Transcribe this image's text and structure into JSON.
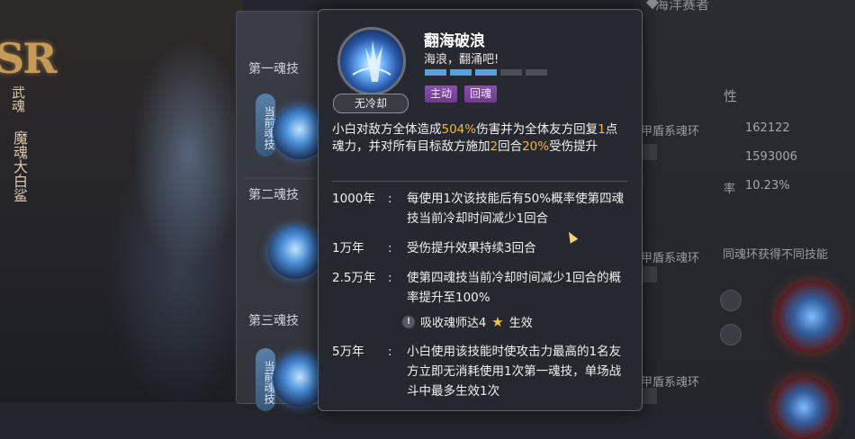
{
  "background": {
    "rank_badge": "SR",
    "hero_vertical_1": "武魂",
    "hero_vertical_2": "魔魂大白鲨",
    "skill_slots": [
      {
        "title": "第一魂技",
        "pre_tag": "当前魂技"
      },
      {
        "title": "第二魂技"
      },
      {
        "title": "第三魂技",
        "pre_tag": "当前魂技"
      }
    ],
    "right_panel": {
      "header": "海洋赛者",
      "partial_attr": "性",
      "rows": [
        {
          "label": "甲盾系魂环",
          "value": "162122"
        },
        {
          "label": "",
          "value": "1593006"
        },
        {
          "label": "率",
          "value": "10.23%"
        }
      ],
      "row2_label": "甲盾系魂环",
      "row3_label": "甲盾系魂环",
      "notice": "同魂环获得不同技能"
    }
  },
  "tooltip": {
    "skill_name": "翻海破浪",
    "quote": "海浪，翻涌吧!",
    "cooldown_badge": "无冷却",
    "level_pips": {
      "filled": 3,
      "total": 5
    },
    "tags": [
      "主动",
      "回魂"
    ],
    "description": {
      "p1": "小白对敌方全体造成",
      "hl1": "504%",
      "p2": "伤害并为全体友方回复",
      "hl2": "1",
      "p3": "点魂力，并对所有目标敌方施加",
      "hl3": "2",
      "p4": "回合",
      "hl4": "20%",
      "p5": "受伤提升"
    },
    "levels": [
      {
        "key": "1000年",
        "colon": ":",
        "text": "每使用1次该技能后有50%概率使第四魂技当前冷却时间减少1回合"
      },
      {
        "key": "1万年",
        "colon": ":",
        "text": "受伤提升效果持续3回合"
      },
      {
        "key": "2.5万年",
        "colon": ":",
        "text": "使第四魂技当前冷却时间减少1回合的概率提升至100%"
      },
      {
        "key": "5万年",
        "colon": ":",
        "text": "小白使用该技能时使攻击力最高的1名友方立即无消耗使用1次第一魂技，单场战斗中最多生效1次"
      }
    ],
    "condition": {
      "prefix": "吸收魂师达4",
      "suffix": "生效",
      "icon": "star-icon",
      "excl": "!"
    }
  },
  "colors": {
    "highlight": "#f2b63a",
    "tag_bg": "#7c45a0",
    "pip_on": "#5a9fd6"
  }
}
